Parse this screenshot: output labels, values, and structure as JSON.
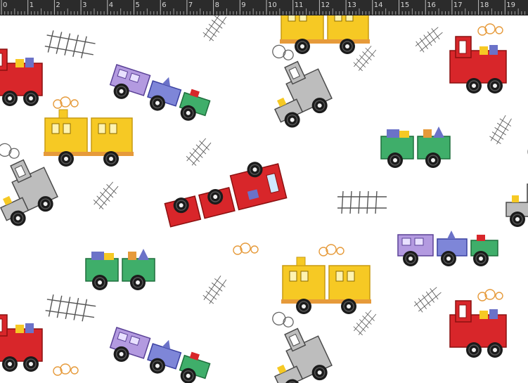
{
  "ruler": {
    "labels": [
      "0",
      "1",
      "2",
      "3",
      "4",
      "5",
      "6",
      "7",
      "8",
      "9",
      "10",
      "11",
      "12",
      "13",
      "14",
      "15",
      "16",
      "17",
      "18",
      "19"
    ]
  },
  "colors": {
    "ruler_bg": "#2b2b2b",
    "ruler_text": "#d8d8d8",
    "canvas_bg": "#ffffff",
    "red": "#d8262a",
    "yellow": "#f6c924",
    "purple": "#9a7fd0",
    "blue": "#6b72c8",
    "green": "#2f9e5c",
    "gray": "#9a9a9a",
    "orange": "#e69a3a"
  },
  "pattern": {
    "description_icons": [
      "train-icon",
      "truck-icon",
      "rail-track-icon",
      "smoke-icon"
    ]
  }
}
